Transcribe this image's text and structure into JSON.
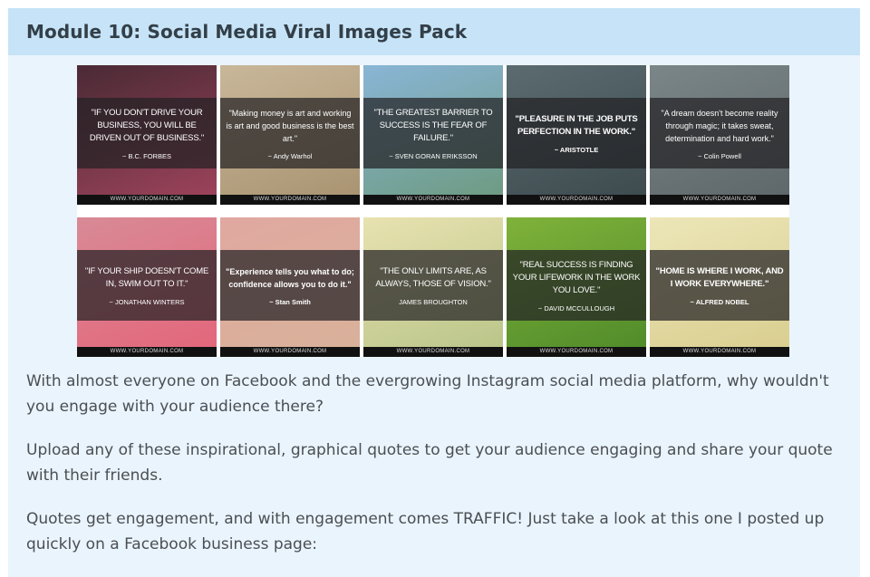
{
  "module": {
    "title": "Module 10: Social Media Viral Images Pack"
  },
  "images": [
    {
      "quote": "\"If you don't drive your business, you will be driven out of business.\"",
      "author": "~ B.C. Forbes",
      "footer": "WWW.YOURDOMAIN.COM",
      "bg_top": "#4a2a35",
      "bg_bottom": "#a0445c"
    },
    {
      "quote": "\"Making money is art and working is art and good business is the best art.\"",
      "author": "~ Andy Warhol",
      "footer": "WWW.YOURDOMAIN.COM",
      "bg_top": "#c9b79a",
      "bg_bottom": "#a89270"
    },
    {
      "quote": "\"The greatest barrier to success is the fear of failure.\"",
      "author": "~ Sven Goran Eriksson",
      "footer": "WWW.YOURDOMAIN.COM",
      "bg_top": "#8ab5d6",
      "bg_bottom": "#6c9a7e"
    },
    {
      "quote": "\"Pleasure in the job puts perfection in the work.\"",
      "author": "~ Aristotle",
      "footer": "WWW.YOURDOMAIN.COM",
      "bg_top": "#5b6b6f",
      "bg_bottom": "#3c4a4e"
    },
    {
      "quote": "\"A dream doesn't become reality through magic; it takes sweat, determination and hard work.\"",
      "author": "~ Colin Powell",
      "footer": "WWW.YOURDOMAIN.COM",
      "bg_top": "#7b8688",
      "bg_bottom": "#5d6669"
    },
    {
      "quote": "\"If your ship doesn't come in, swim out to it.\"",
      "author": "~ Jonathan Winters",
      "footer": "WWW.YOURDOMAIN.COM",
      "bg_top": "#d88a96",
      "bg_bottom": "#e4657a"
    },
    {
      "quote": "\"Experience tells you what to do; confidence allows you to do it.\"",
      "author": "~ Stan Smith",
      "footer": "WWW.YOURDOMAIN.COM",
      "bg_top": "#e0a8a0",
      "bg_bottom": "#d8b29a"
    },
    {
      "quote": "\"The only limits are, as always, those of vision.\"",
      "author": "James Broughton",
      "footer": "WWW.YOURDOMAIN.COM",
      "bg_top": "#e8e2b0",
      "bg_bottom": "#b8c488"
    },
    {
      "quote": "\"Real success is finding your lifework in the work you love.\"",
      "author": "~ David McCullough",
      "footer": "WWW.YOURDOMAIN.COM",
      "bg_top": "#7fb23a",
      "bg_bottom": "#4f8a2a"
    },
    {
      "quote": "\"Home is where I work, and I work everywhere.\"",
      "author": "~ Alfred Nobel",
      "footer": "WWW.YOURDOMAIN.COM",
      "bg_top": "#ece6b8",
      "bg_bottom": "#d9cd8e"
    }
  ],
  "paragraphs": [
    "With almost everyone on Facebook and the evergrowing Instagram social media platform, why wouldn't you engage with your audience there?",
    "Upload any of these inspirational, graphical quotes to get your audience engaging and share your quote with their friends.",
    "Quotes get engagement, and with engagement comes TRAFFIC! Just take a look at this one I posted up quickly on a Facebook business page:"
  ]
}
